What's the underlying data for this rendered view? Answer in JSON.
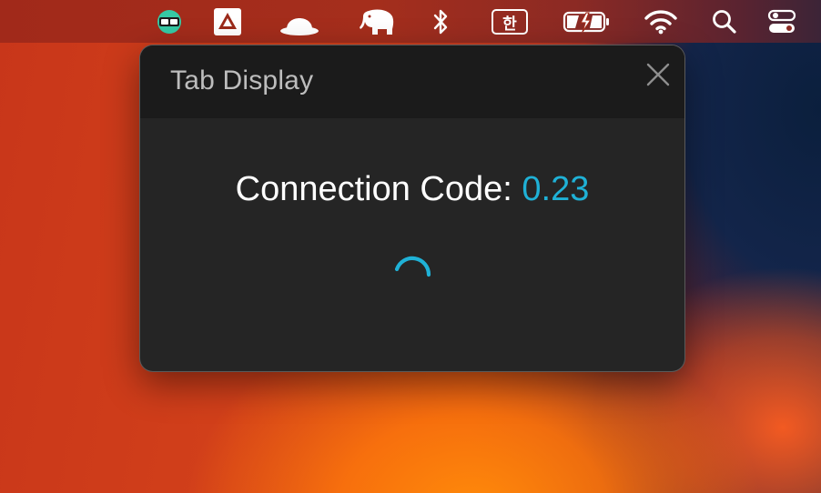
{
  "menubar": {
    "items": [
      {
        "name": "tab-display-status-icon"
      },
      {
        "name": "drive-icon"
      },
      {
        "name": "bowler-hat-icon"
      },
      {
        "name": "elephant-icon"
      },
      {
        "name": "bluetooth-icon"
      },
      {
        "name": "input-source-hangul-icon",
        "text": "한"
      },
      {
        "name": "battery-charging-icon"
      },
      {
        "name": "wifi-icon"
      },
      {
        "name": "spotlight-search-icon"
      },
      {
        "name": "control-center-icon"
      }
    ]
  },
  "dialog": {
    "title": "Tab Display",
    "connection_label": "Connection Code: ",
    "connection_code": "0.23",
    "colors": {
      "accent": "#1fb1d6",
      "window_bg": "#252525",
      "titlebar_bg": "#1b1b1b"
    }
  }
}
